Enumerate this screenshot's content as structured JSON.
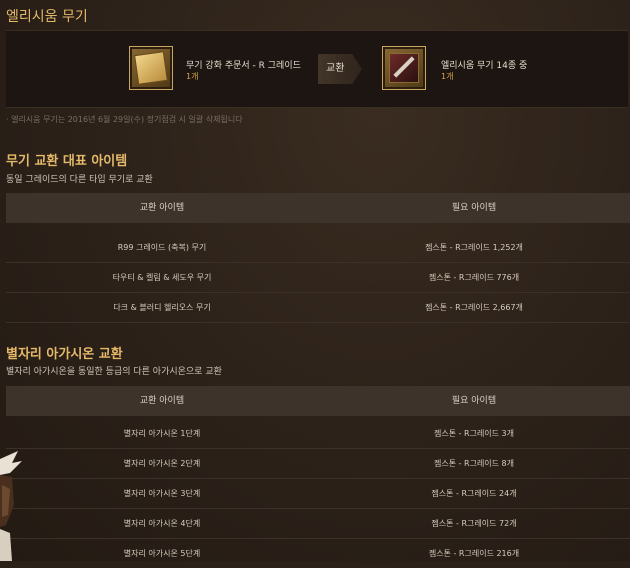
{
  "page": {
    "title": "엘리시움 무기",
    "notice": "· 엘리시움 무기는 2016년 6월 29일(수) 정기점검 시 일괄 삭제됩니다"
  },
  "exchange": {
    "source": {
      "name": "무기 강화 주문서 - R 그레이드",
      "qty": "1개",
      "icon": "enchant-scroll-icon"
    },
    "arrow_label": "교환",
    "target": {
      "name": "엘리시움 무기  14종 중",
      "qty": "1개",
      "icon": "weapon-icon"
    }
  },
  "section1": {
    "title": "무기 교환 대표 아이템",
    "desc": "동일 그레이드의 다른 타입 무기로 교환",
    "headers": [
      "교환 아이템",
      "필요 아이템"
    ],
    "rows": [
      [
        "R99 그레이드 (축복) 무기",
        "젬스톤 - R그레이드 1,252개"
      ],
      [
        "타우티 & 켈림 & 세도우 무기",
        "젬스톤 - R그레이드 776개"
      ],
      [
        "다크 & 블러디 헬리오스 무기",
        "젬스톤 - R그레이드 2,667개"
      ]
    ]
  },
  "section2": {
    "title": "별자리 아가시온 교환",
    "desc": "별자리 아가시온을 동일한 등급의 다른 아가시온으로 교환",
    "headers": [
      "교환 아이템",
      "필요 아이템"
    ],
    "rows": [
      [
        "별자리 아가시온 1단계",
        "젬스톤 - R그레이드 3개"
      ],
      [
        "별자리 아가시온 2단계",
        "젬스톤 - R그레이드 8개"
      ],
      [
        "별자리 아가시온 3단계",
        "젬스톤 - R그레이드 24개"
      ],
      [
        "별자리 아가시온 4단계",
        "젬스톤 - R그레이드 72개"
      ],
      [
        "별자리 아가시온 5단계",
        "젬스톤 - R그레이드 216개"
      ]
    ]
  },
  "colors": {
    "accent": "#e5b96a",
    "qty": "#d9a64a",
    "background": "#2b2119"
  }
}
